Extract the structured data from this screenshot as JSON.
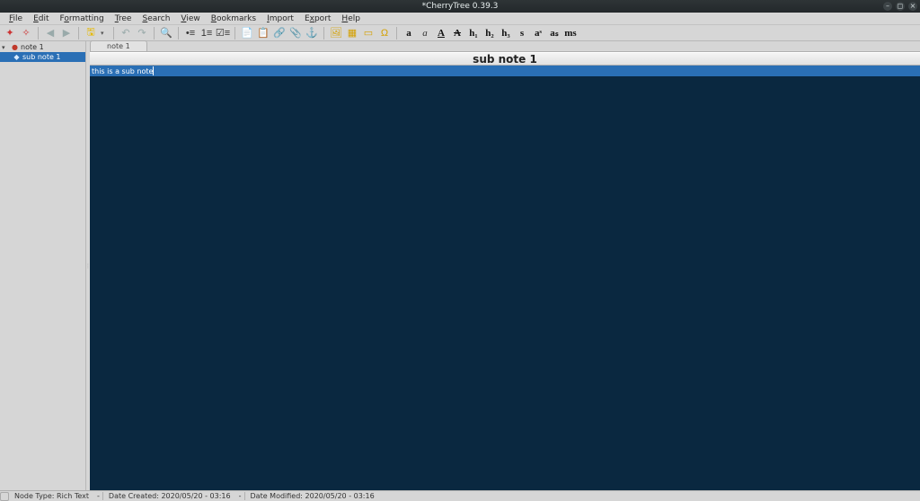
{
  "titlebar": {
    "title": "*CherryTree 0.39.3"
  },
  "menu": {
    "file": "File",
    "edit": "Edit",
    "formatting": "Formatting",
    "tree": "Tree",
    "search": "Search",
    "view": "View",
    "bookmarks": "Bookmarks",
    "import": "Import",
    "export": "Export",
    "help": "Help"
  },
  "tree": {
    "root": {
      "label": "note 1"
    },
    "child": {
      "label": "sub note 1"
    }
  },
  "tabs": {
    "tab1": "note 1"
  },
  "node_title": "sub note 1",
  "editor": {
    "line1": "this is a sub note"
  },
  "status": {
    "node_type": "Node Type: Rich Text",
    "created": "Date Created: 2020/05/20 - 03:16",
    "modified": "Date Modified: 2020/05/20 - 03:16"
  },
  "toolbar_labels": {
    "bold": "a",
    "italic": "a",
    "underline": "A",
    "strike": "A",
    "h1": "h₁",
    "h2": "h₂",
    "h3": "h₃",
    "small": "s",
    "sup": "aˢ",
    "sub": "aₛ",
    "mono": "ms"
  }
}
